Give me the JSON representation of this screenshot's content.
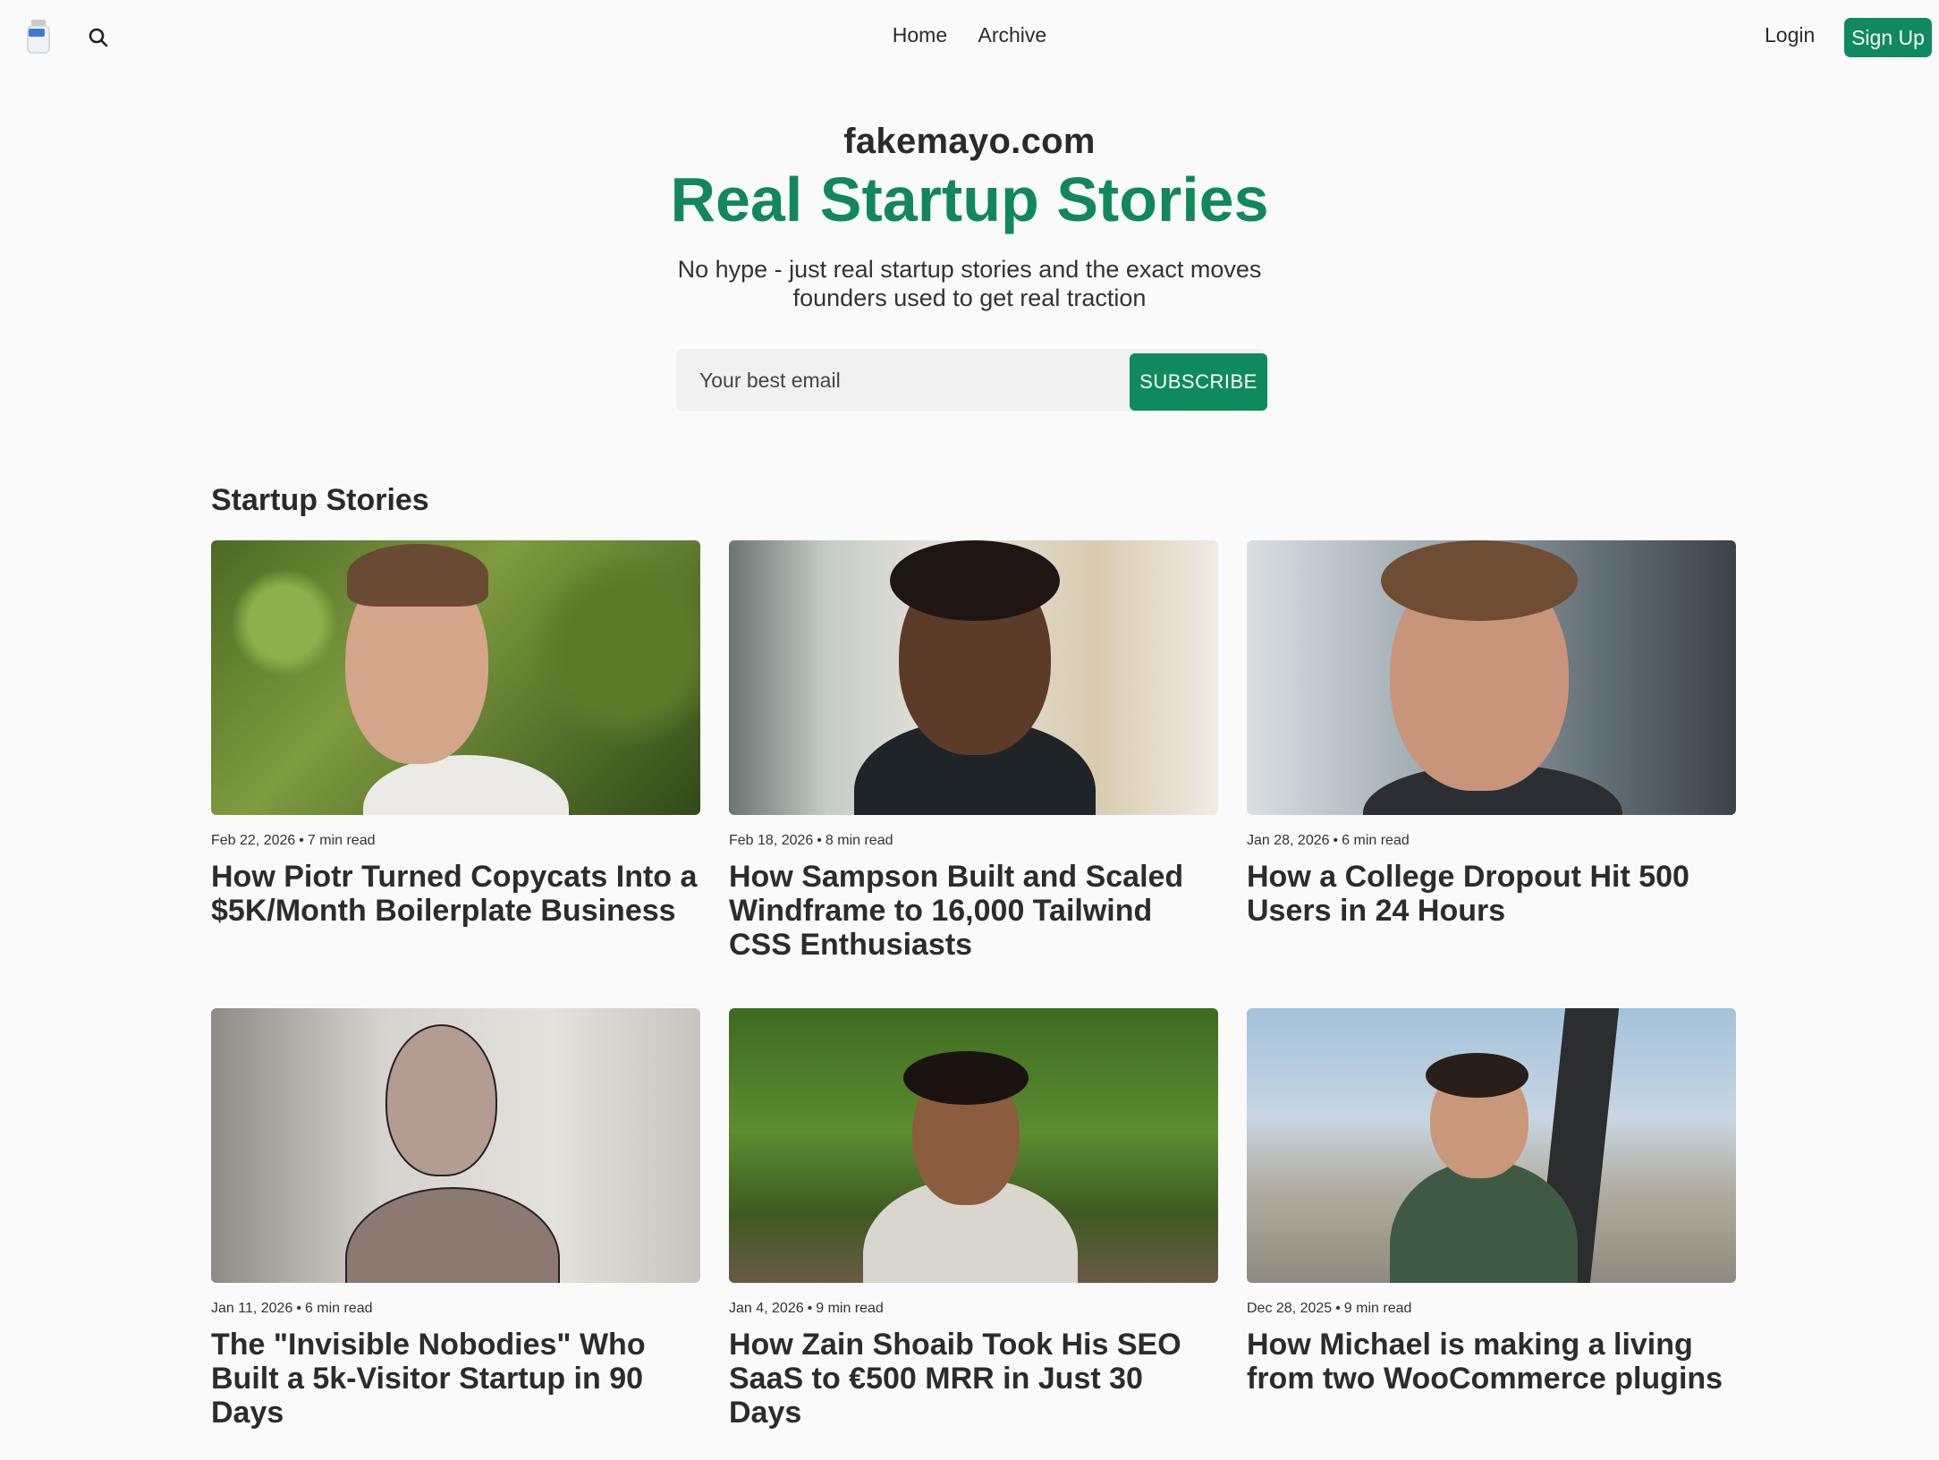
{
  "header": {
    "nav": [
      "Home",
      "Archive"
    ],
    "login": "Login",
    "signup": "Sign Up"
  },
  "hero": {
    "site_name": "fakemayo.com",
    "headline": "Real Startup Stories",
    "tagline": "No hype - just real startup stories and the exact moves founders used to get real traction",
    "email_placeholder": "Your best email",
    "subscribe_label": "SUBSCRIBE"
  },
  "section_title": "Startup Stories",
  "stories": [
    {
      "date": "Feb 22, 2026",
      "read": "7 min read",
      "title": "How Piotr Turned Copycats Into a $5K/Month Boilerplate Business"
    },
    {
      "date": "Feb 18, 2026",
      "read": "8 min read",
      "title": "How Sampson Built and Scaled Windframe to 16,000 Tailwind CSS Enthusiasts"
    },
    {
      "date": "Jan 28, 2026",
      "read": "6 min read",
      "title": "How a College Dropout Hit 500 Users in 24 Hours"
    },
    {
      "date": "Jan 11, 2026",
      "read": "6 min read",
      "title": "The \"Invisible Nobodies\" Who Built a 5k-Visitor Startup in 90 Days"
    },
    {
      "date": "Jan 4, 2026",
      "read": "9 min read",
      "title": "How Zain Shoaib Took His SEO SaaS to €500 MRR in Just 30 Days"
    },
    {
      "date": "Dec 28, 2025",
      "read": "9 min read",
      "title": "How Michael is making a living from two WooCommerce plugins"
    }
  ],
  "colors": {
    "accent": "#0f8a5f",
    "background": "#fafafa"
  },
  "icons": {
    "logo": "mayo-jar-icon",
    "search": "search-icon"
  }
}
